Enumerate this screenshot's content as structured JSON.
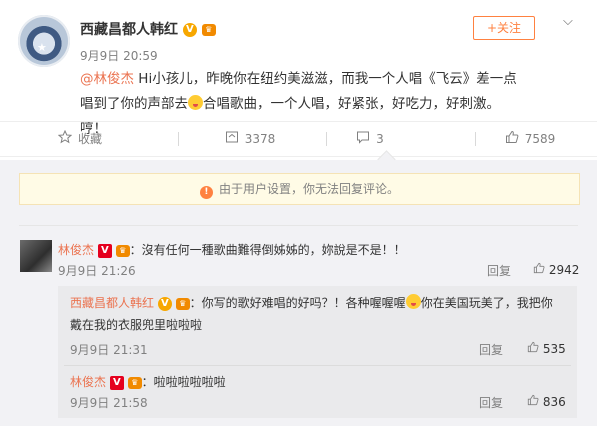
{
  "post": {
    "author": "西藏昌都人韩红",
    "time": "9月9日 20:59",
    "follow_label": "+关注",
    "mention": "@林俊杰",
    "text_a": " Hi小孩儿，昨晚你在纽约美滋滋，而我一个人唱《飞云》差一点唱到了你的声部去",
    "text_b": "合唱歌曲，一个人唱，好紧张，好吃力，好刺激。哼！"
  },
  "actions": {
    "collect": "收藏",
    "reposts": "3378",
    "comments": "3",
    "likes": "7589"
  },
  "notice": "由于用户设置，你无法回复评论。",
  "comments": [
    {
      "author": "林俊杰",
      "text": "：沒有任何一種歌曲難得倒姊姊的，妳說是不是！！",
      "time": "9月9日 21:26",
      "reply": "回复",
      "likes": "2942"
    },
    {
      "author": "西藏昌都人韩红",
      "text_a": "：你写的歌好难唱的好吗？！各种喔喔喔",
      "text_b": "你在美国玩美了，我把你",
      "text_c": "戴在我的衣服兜里啦啦啦",
      "time": "9月9日 21:31",
      "reply": "回复",
      "likes": "535"
    },
    {
      "author": "林俊杰",
      "text": "：啦啦啦啦啦啦",
      "time": "9月9日 21:58",
      "reply": "回复",
      "likes": "836"
    }
  ],
  "colors": {
    "accent": "#eb7350",
    "follow": "#ff8140",
    "gold": "#f7a700"
  }
}
